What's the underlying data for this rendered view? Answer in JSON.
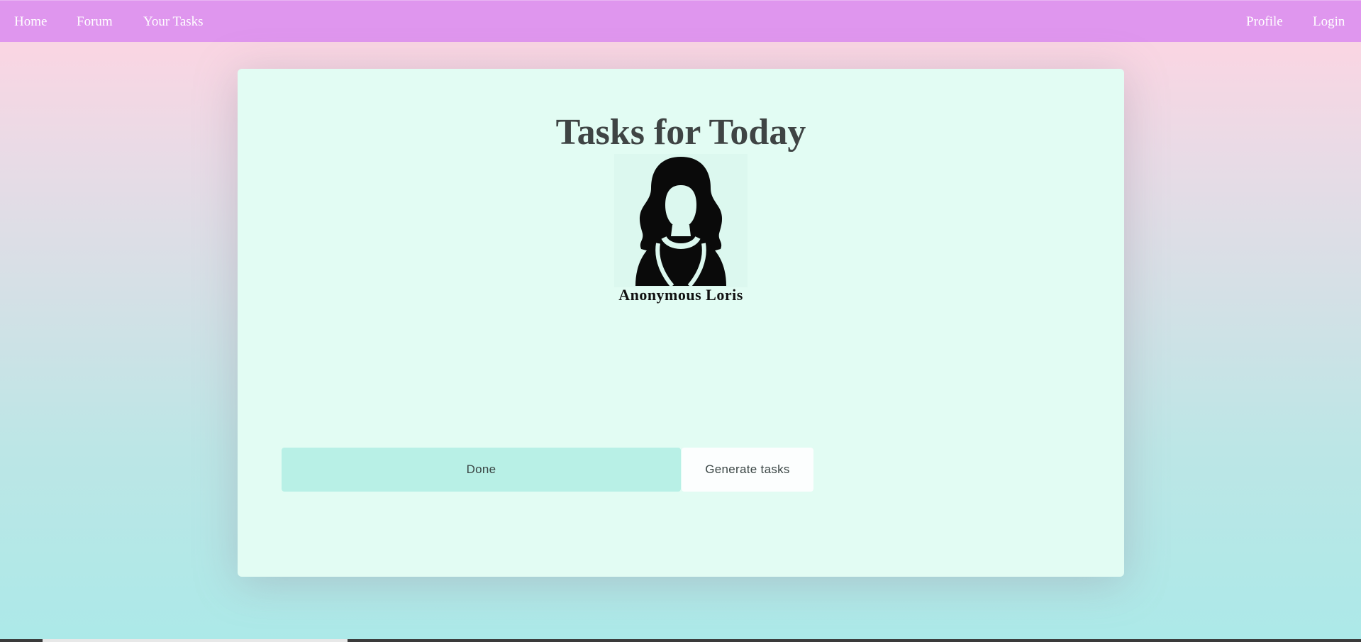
{
  "nav": {
    "home": "Home",
    "forum": "Forum",
    "your_tasks": "Your Tasks",
    "profile": "Profile",
    "login": "Login"
  },
  "main": {
    "title": "Tasks for Today",
    "avatar_icon": "user-avatar-icon",
    "user_name": "Anonymous Loris",
    "done_label": "Done",
    "generate_label": "Generate tasks"
  },
  "colors": {
    "navbar": "#df96ee",
    "card": "#e2fcf3",
    "done_button": "#b8f0e6",
    "generate_button": "#fcfefe"
  }
}
